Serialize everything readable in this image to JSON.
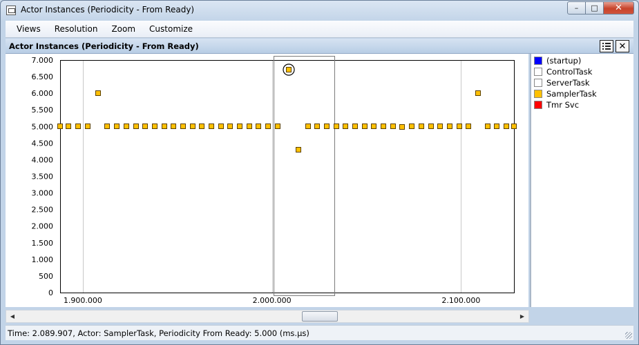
{
  "window": {
    "title": "Actor Instances (Periodicity - From Ready)",
    "controls": {
      "minimize": "–",
      "maximize": "□",
      "close": "✕"
    }
  },
  "menu": [
    "Views",
    "Resolution",
    "Zoom",
    "Customize"
  ],
  "panel": {
    "title": "Actor Instances (Periodicity - From Ready)",
    "close_glyph": "✕"
  },
  "icons": {
    "app": "window-icon",
    "legend_toggle": "list-icon",
    "close": "close-icon"
  },
  "legend": [
    {
      "name": "(startup)",
      "color": "#0000ff"
    },
    {
      "name": "ControlTask",
      "color": "#ffffff"
    },
    {
      "name": "ServerTask",
      "color": "#ffffff"
    },
    {
      "name": "SamplerTask",
      "color": "#ffc000"
    },
    {
      "name": "Tmr Svc",
      "color": "#ff0000"
    }
  ],
  "chart_data": {
    "type": "scatter",
    "ylim": [
      0,
      7
    ],
    "xlim": [
      1888000,
      2128000
    ],
    "y_ticks": [
      0,
      0.5,
      1,
      1.5,
      2,
      2.5,
      3,
      3.5,
      4,
      4.5,
      5,
      5.5,
      6,
      6.5,
      7
    ],
    "y_tick_labels": [
      "0",
      "500",
      "1.000",
      "1.500",
      "2.000",
      "2.500",
      "3.000",
      "3.500",
      "4.000",
      "4.500",
      "5.000",
      "5.500",
      "6.000",
      "6.500",
      "7.000"
    ],
    "x_ticks": [
      1900000,
      2000000,
      2100000
    ],
    "x_tick_labels": [
      "1.900.000",
      "2.000.000",
      "2.100.000"
    ],
    "grid": true,
    "series": [
      {
        "name": "SamplerTask",
        "color": "#ffc000",
        "points": [
          [
            1888000,
            5.0
          ],
          [
            1892500,
            5.0
          ],
          [
            1897500,
            5.0
          ],
          [
            1902500,
            5.0
          ],
          [
            1908000,
            6.0
          ],
          [
            1913000,
            5.0
          ],
          [
            1918000,
            5.0
          ],
          [
            1923000,
            5.0
          ],
          [
            1928000,
            5.0
          ],
          [
            1933000,
            5.0
          ],
          [
            1938000,
            5.0
          ],
          [
            1943000,
            5.0
          ],
          [
            1948000,
            5.0
          ],
          [
            1953000,
            5.0
          ],
          [
            1958000,
            5.0
          ],
          [
            1963000,
            5.0
          ],
          [
            1968000,
            5.0
          ],
          [
            1973000,
            5.0
          ],
          [
            1978000,
            5.0
          ],
          [
            1983000,
            5.0
          ],
          [
            1988000,
            5.0
          ],
          [
            1993000,
            5.0
          ],
          [
            1998000,
            5.0
          ],
          [
            2003000,
            5.0
          ],
          [
            2009000,
            6.7
          ],
          [
            2014000,
            4.3
          ],
          [
            2019000,
            5.0
          ],
          [
            2024000,
            5.0
          ],
          [
            2029000,
            5.0
          ],
          [
            2034000,
            5.0
          ],
          [
            2039000,
            5.0
          ],
          [
            2044000,
            5.0
          ],
          [
            2049000,
            5.0
          ],
          [
            2054000,
            5.0
          ],
          [
            2059000,
            5.0
          ],
          [
            2064000,
            5.0
          ],
          [
            2069000,
            4.99
          ],
          [
            2074000,
            5.0
          ],
          [
            2079000,
            5.0
          ],
          [
            2084000,
            5.0
          ],
          [
            2089000,
            5.0
          ],
          [
            2094000,
            5.0
          ],
          [
            2099000,
            5.0
          ],
          [
            2104000,
            5.0
          ],
          [
            2109000,
            6.0
          ],
          [
            2114000,
            5.0
          ],
          [
            2119000,
            5.0
          ],
          [
            2124000,
            5.0
          ],
          [
            2128000,
            5.0
          ]
        ]
      }
    ],
    "highlighted_point": [
      2009000,
      6.7
    ],
    "selection_x": [
      2001000,
      2033000
    ]
  },
  "status": {
    "text": "Time: 2.089.907, Actor: SamplerTask, Periodicity From Ready: 5.000 (ms.µs)"
  }
}
